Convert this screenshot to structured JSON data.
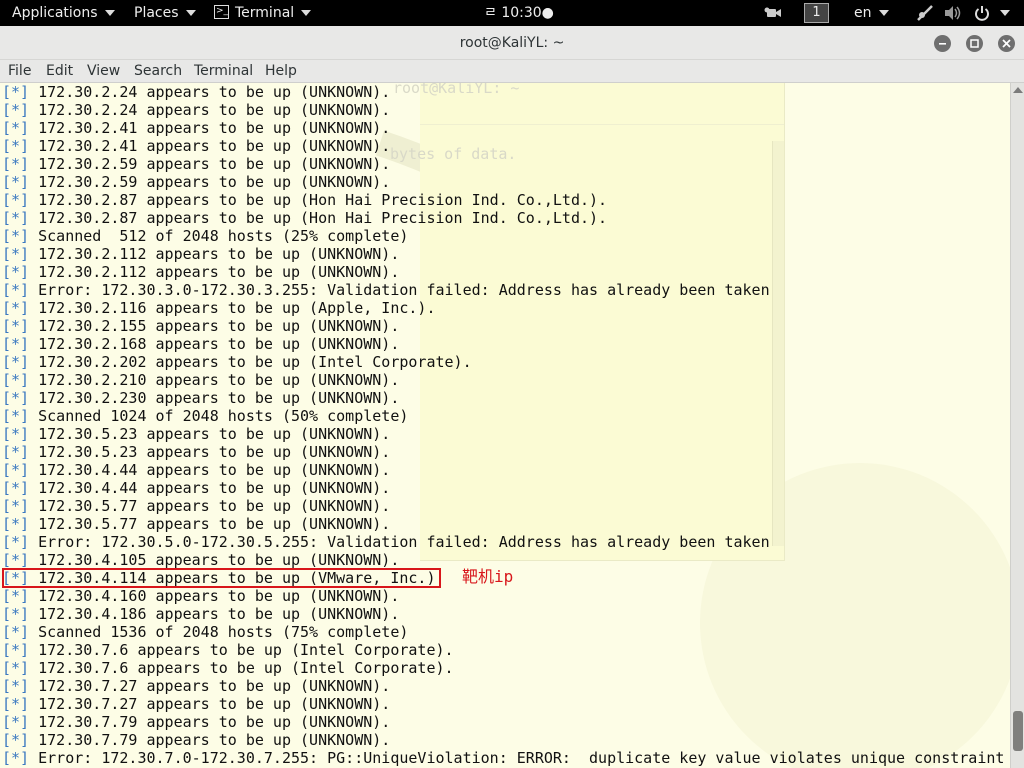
{
  "topbar": {
    "applications": "Applications",
    "places": "Places",
    "terminal_menu": "Terminal",
    "clock": "ㄹ 10:30●",
    "workspace": "1",
    "language": "en"
  },
  "window": {
    "title": "root@KaliYL: ~"
  },
  "menubar": [
    "File",
    "Edit",
    "View",
    "Search",
    "Terminal",
    "Help"
  ],
  "background_ghost": {
    "title": "root@KaliYL: ~",
    "text": "bytes of data."
  },
  "prefix": "[*]",
  "lines": [
    "172.30.2.24 appears to be up (UNKNOWN).",
    "172.30.2.24 appears to be up (UNKNOWN).",
    "172.30.2.41 appears to be up (UNKNOWN).",
    "172.30.2.41 appears to be up (UNKNOWN).",
    "172.30.2.59 appears to be up (UNKNOWN).",
    "172.30.2.59 appears to be up (UNKNOWN).",
    "172.30.2.87 appears to be up (Hon Hai Precision Ind. Co.,Ltd.).",
    "172.30.2.87 appears to be up (Hon Hai Precision Ind. Co.,Ltd.).",
    "Scanned  512 of 2048 hosts (25% complete)",
    "172.30.2.112 appears to be up (UNKNOWN).",
    "172.30.2.112 appears to be up (UNKNOWN).",
    "Error: 172.30.3.0-172.30.3.255: Validation failed: Address has already been taken",
    "172.30.2.116 appears to be up (Apple, Inc.).",
    "172.30.2.155 appears to be up (UNKNOWN).",
    "172.30.2.168 appears to be up (UNKNOWN).",
    "172.30.2.202 appears to be up (Intel Corporate).",
    "172.30.2.210 appears to be up (UNKNOWN).",
    "172.30.2.230 appears to be up (UNKNOWN).",
    "Scanned 1024 of 2048 hosts (50% complete)",
    "172.30.5.23 appears to be up (UNKNOWN).",
    "172.30.5.23 appears to be up (UNKNOWN).",
    "172.30.4.44 appears to be up (UNKNOWN).",
    "172.30.4.44 appears to be up (UNKNOWN).",
    "172.30.5.77 appears to be up (UNKNOWN).",
    "172.30.5.77 appears to be up (UNKNOWN).",
    "Error: 172.30.5.0-172.30.5.255: Validation failed: Address has already been taken",
    "172.30.4.105 appears to be up (UNKNOWN).",
    "172.30.4.114 appears to be up (VMware, Inc.).",
    "172.30.4.160 appears to be up (UNKNOWN).",
    "172.30.4.186 appears to be up (UNKNOWN).",
    "Scanned 1536 of 2048 hosts (75% complete)",
    "172.30.7.6 appears to be up (Intel Corporate).",
    "172.30.7.6 appears to be up (Intel Corporate).",
    "172.30.7.27 appears to be up (UNKNOWN).",
    "172.30.7.27 appears to be up (UNKNOWN).",
    "172.30.7.79 appears to be up (UNKNOWN).",
    "172.30.7.79 appears to be up (UNKNOWN).",
    "Error: 172.30.7.0-172.30.7.255: PG::UniqueViolation: ERROR:  duplicate key value violates unique constraint"
  ],
  "annotation": {
    "label": "靶机ip",
    "color": "#d8161b"
  },
  "colors": {
    "terminal_bg": "#fdfde6",
    "prefix": "#3a78c0"
  }
}
